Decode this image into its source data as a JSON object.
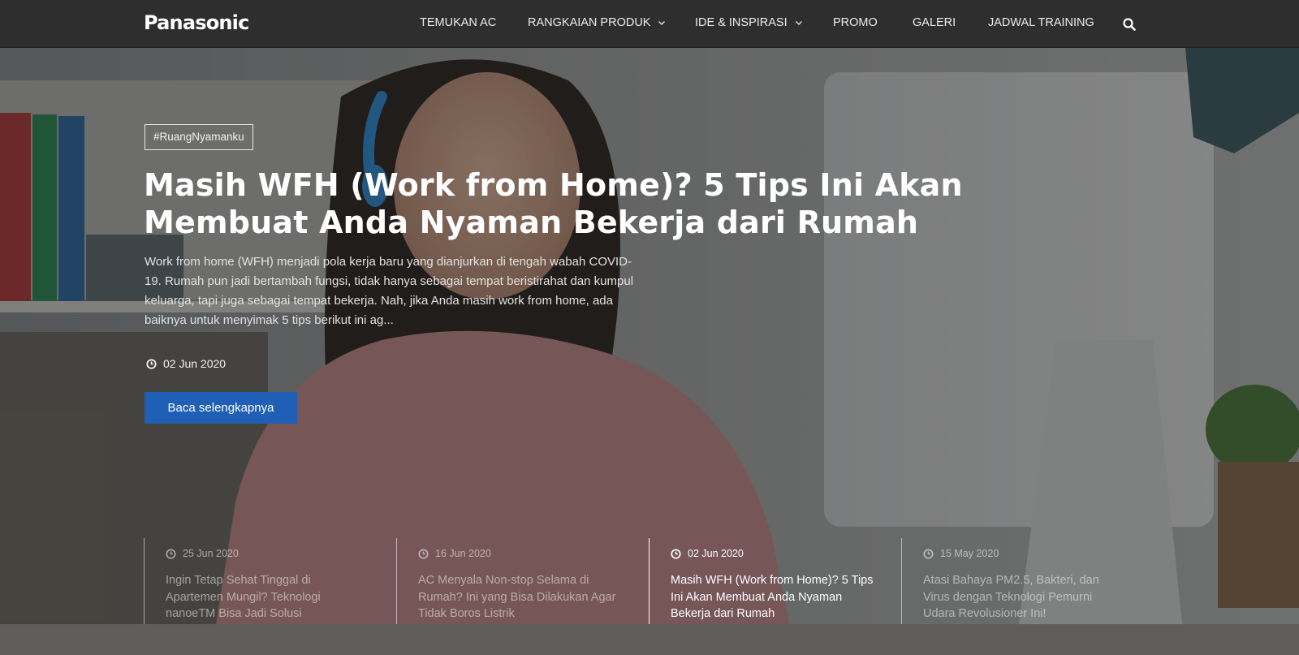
{
  "brand": {
    "logo_text": "Panasonic"
  },
  "nav": {
    "items": [
      {
        "label": "TEMUKAN AC",
        "has_dropdown": false
      },
      {
        "label": "RANGKAIAN PRODUK",
        "has_dropdown": true
      },
      {
        "label": "IDE & INSPIRASI",
        "has_dropdown": true
      },
      {
        "label": "PROMO",
        "has_dropdown": false
      },
      {
        "label": "GALERI",
        "has_dropdown": false
      },
      {
        "label": "JADWAL TRAINING",
        "has_dropdown": false
      }
    ],
    "search_icon": "search-icon"
  },
  "hero": {
    "tag": "#RuangNyamanku",
    "title": "Masih WFH (Work from Home)? 5 Tips Ini Akan Membuat Anda Nyaman Bekerja dari Rumah",
    "excerpt": "Work from home (WFH) menjadi pola kerja baru yang dianjurkan di tengah wabah COVID-19. Rumah pun jadi bertambah fungsi, tidak hanya sebagai tempat beristirahat dan kumpul keluarga, tapi juga sebagai tempat bekerja. Nah, jika Anda masih work from home, ada baiknya untuk menyimak 5 tips berikut ini ag...",
    "date": "02 Jun 2020",
    "cta_label": "Baca selengkapnya"
  },
  "articles": [
    {
      "date": "25 Jun 2020",
      "title": "Ingin Tetap Sehat Tinggal di Apartemen Mungil? Teknologi nanoeTM Bisa Jadi Solusi",
      "active": false
    },
    {
      "date": "16 Jun 2020",
      "title": "AC Menyala Non-stop Selama di Rumah? Ini yang Bisa Dilakukan Agar Tidak Boros Listrik",
      "active": false
    },
    {
      "date": "02 Jun 2020",
      "title": "Masih WFH (Work from Home)? 5 Tips Ini Akan Membuat Anda Nyaman Bekerja dari Rumah",
      "active": true
    },
    {
      "date": "15 May 2020",
      "title": "Atasi Bahaya PM2.5, Bakteri, dan Virus dengan Teknologi Pemurni Udara Revolusioner Ini!",
      "active": false
    }
  ],
  "colors": {
    "header_bg": "#2e2e2e",
    "cta_bg": "#1f5fb5",
    "accent_blue_headset": "#2f8fd8"
  }
}
